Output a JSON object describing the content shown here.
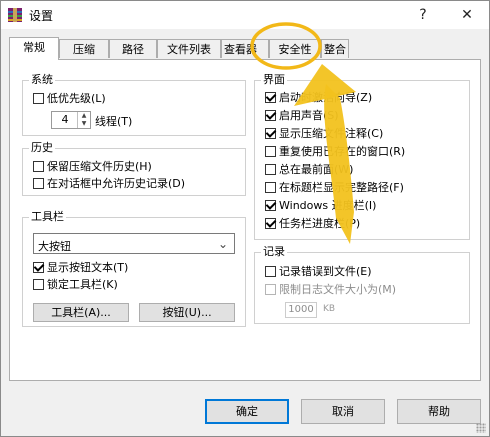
{
  "window": {
    "title": "设置",
    "help_label": "?",
    "close_label": "✕"
  },
  "tabs": [
    "常规",
    "压缩",
    "路径",
    "文件列表",
    "查看器",
    "安全性",
    "整合"
  ],
  "active_tab_index": 0,
  "system": {
    "title": "系统",
    "low_priority": {
      "label": "低优先级(L)",
      "checked": false
    },
    "threads": {
      "value": "4",
      "label": "线程(T)"
    }
  },
  "history": {
    "title": "历史",
    "items": [
      {
        "label": "保留压缩文件历史(H)",
        "checked": false
      },
      {
        "label": "在对话框中允许历史记录(D)",
        "checked": false
      }
    ]
  },
  "toolbar": {
    "title": "工具栏",
    "size_selected": "大按钮",
    "items": [
      {
        "label": "显示按钮文本(T)",
        "checked": true
      },
      {
        "label": "锁定工具栏(K)",
        "checked": false
      }
    ],
    "toolbar_button": "工具栏(A)...",
    "buttons_button": "按钮(U)..."
  },
  "interface": {
    "title": "界面",
    "items": [
      {
        "label": "启动时激活向导(Z)",
        "checked": true
      },
      {
        "label": "启用声音(S)",
        "checked": true
      },
      {
        "label": "显示压缩文件注释(C)",
        "checked": true
      },
      {
        "label": "重复使用已存在的窗口(R)",
        "checked": false
      },
      {
        "label": "总在最前面(W)",
        "checked": false
      },
      {
        "label": "在标题栏显示完整路径(F)",
        "checked": false
      },
      {
        "label": "Windows 进度栏(I)",
        "checked": true
      },
      {
        "label": "任务栏进度栏(P)",
        "checked": true
      }
    ]
  },
  "log": {
    "title": "记录",
    "log_errors": {
      "label": "记录错误到文件(E)",
      "checked": false
    },
    "limit_size": {
      "label": "限制日志文件大小为(M)",
      "checked": false
    },
    "size_value": "1000",
    "size_unit": "KB"
  },
  "footer": {
    "ok": "确定",
    "cancel": "取消",
    "help": "帮助"
  },
  "colors": {
    "annotation_circle": "#f2b818",
    "annotation_arrow": "#f2c21e",
    "accent": "#0078d7"
  },
  "annotation": {
    "circle_target": "安全性",
    "arrow_icon": "pointer-arrow"
  }
}
